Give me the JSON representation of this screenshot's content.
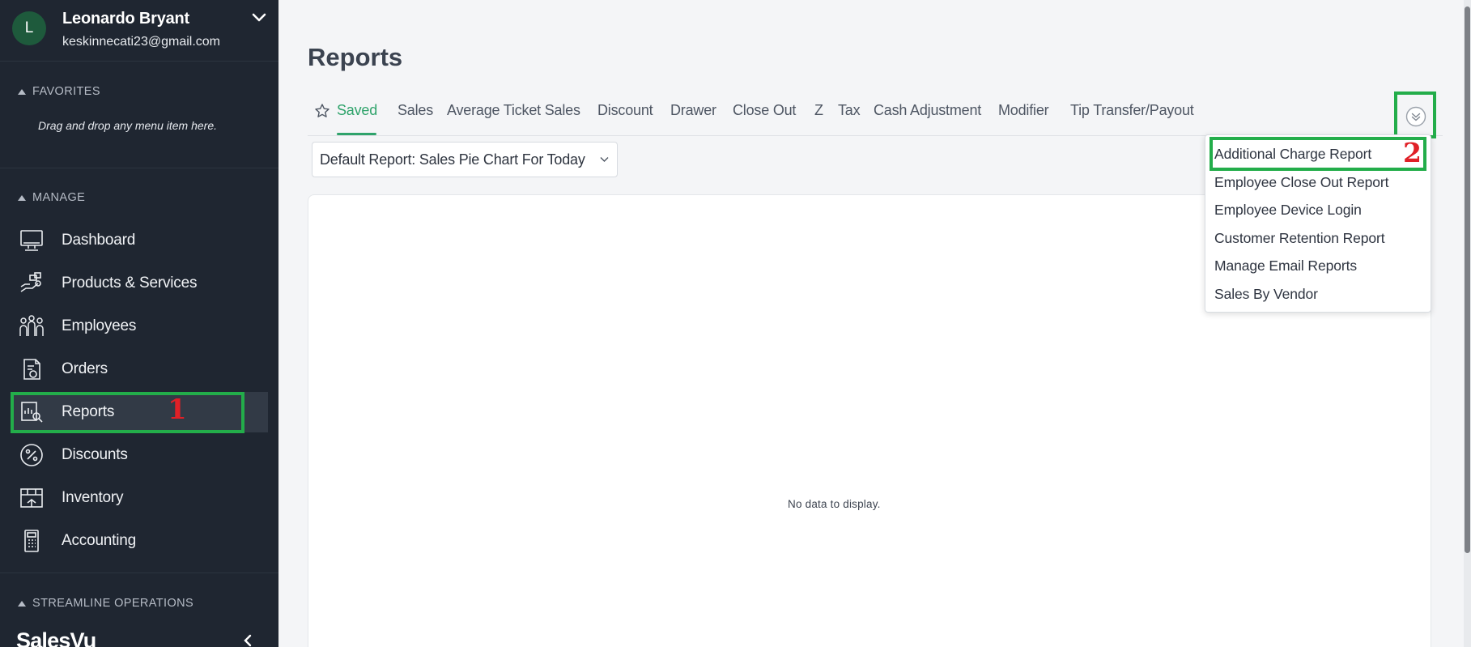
{
  "user": {
    "initial": "L",
    "name": "Leonardo Bryant",
    "email": "keskinnecati23@gmail.com"
  },
  "sidebar": {
    "favorites_header": "FAVORITES",
    "favorites_hint": "Drag and drop any menu item here.",
    "manage_header": "MANAGE",
    "items": [
      {
        "label": "Dashboard",
        "icon": "monitor-icon"
      },
      {
        "label": "Products & Services",
        "icon": "product-box-icon"
      },
      {
        "label": "Employees",
        "icon": "employees-icon"
      },
      {
        "label": "Orders",
        "icon": "orders-icon"
      },
      {
        "label": "Reports",
        "icon": "reports-icon",
        "active": true
      },
      {
        "label": "Discounts",
        "icon": "percent-icon"
      },
      {
        "label": "Inventory",
        "icon": "inventory-icon"
      },
      {
        "label": "Accounting",
        "icon": "calculator-icon"
      }
    ],
    "streamline_header": "STREAMLINE OPERATIONS",
    "brand": "SalesVu"
  },
  "main": {
    "title": "Reports",
    "tabs": [
      {
        "label": "Saved",
        "active": true
      },
      {
        "label": "Sales"
      },
      {
        "label": "Average Ticket Sales"
      },
      {
        "label": "Discount"
      },
      {
        "label": "Drawer"
      },
      {
        "label": "Close Out"
      },
      {
        "label": "Z"
      },
      {
        "label": "Tax"
      },
      {
        "label": "Cash Adjustment"
      },
      {
        "label": "Modifier"
      },
      {
        "label": "Tip Transfer/Payout"
      }
    ],
    "default_report": "Default Report: Sales Pie Chart For Today",
    "no_data": "No data to display.",
    "more_menu": [
      "Additional Charge Report",
      "Employee Close Out Report",
      "Employee Device Login",
      "Customer Retention Report",
      "Manage Email Reports",
      "Sales By Vendor"
    ]
  },
  "annotations": {
    "step1": "1",
    "step2": "2"
  },
  "colors": {
    "sidebar_bg": "#1f2631",
    "accent_green": "#2fa36b",
    "highlight_green": "#23ad4a",
    "annotation_red": "#e02027"
  }
}
